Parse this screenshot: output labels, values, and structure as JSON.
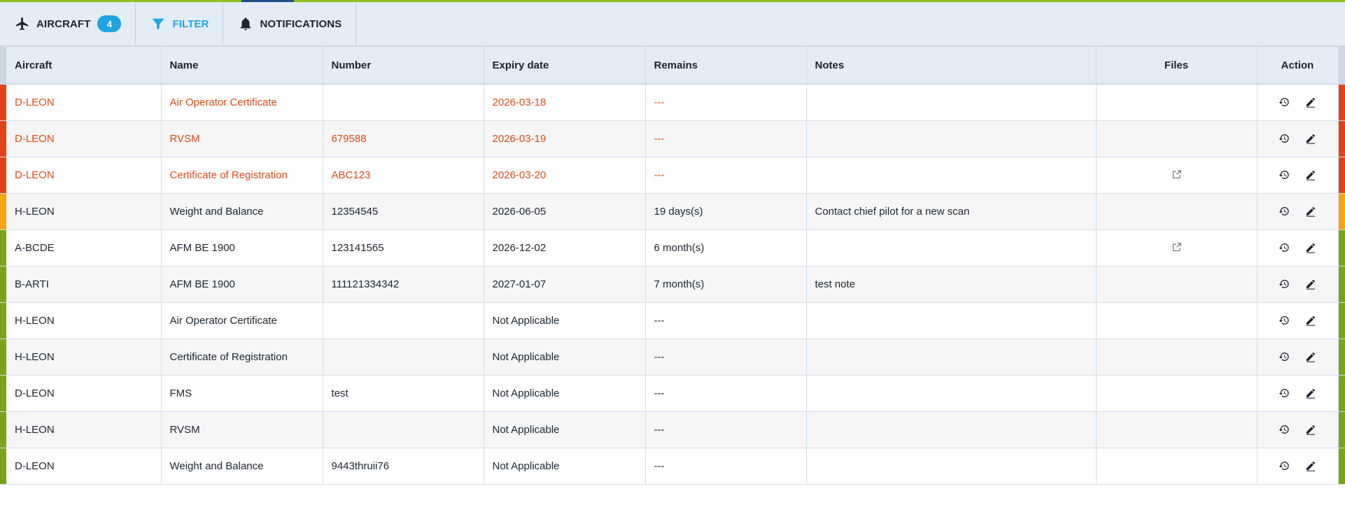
{
  "toolbar": {
    "tabs": [
      {
        "label": "AIRCRAFT",
        "icon": "airplane-icon",
        "badge": "4"
      },
      {
        "label": "FILTER",
        "icon": "funnel-icon"
      },
      {
        "label": "NOTIFICATIONS",
        "icon": "bell-icon"
      }
    ],
    "accent_color": "#1ea5e0"
  },
  "table": {
    "columns": [
      "Aircraft",
      "Name",
      "Number",
      "Expiry date",
      "Remains",
      "Notes",
      "Files",
      "Action"
    ],
    "rows": [
      {
        "aircraft": "D-LEON",
        "name": "Air Operator Certificate",
        "number": "",
        "expiry": "2026-03-18",
        "remains": "---",
        "notes": "",
        "file": false,
        "status": "red"
      },
      {
        "aircraft": "D-LEON",
        "name": "RVSM",
        "number": "679588",
        "expiry": "2026-03-19",
        "remains": "---",
        "notes": "",
        "file": false,
        "status": "red"
      },
      {
        "aircraft": "D-LEON",
        "name": "Certificate of Registration",
        "number": "ABC123",
        "expiry": "2026-03-20",
        "remains": "---",
        "notes": "",
        "file": true,
        "status": "red"
      },
      {
        "aircraft": "H-LEON",
        "name": "Weight and Balance",
        "number": "12354545",
        "expiry": "2026-06-05",
        "remains": "19 days(s)",
        "notes": "Contact chief pilot for a new scan",
        "file": false,
        "status": "orange"
      },
      {
        "aircraft": "A-BCDE",
        "name": "AFM BE 1900",
        "number": "123141565",
        "expiry": "2026-12-02",
        "remains": "6 month(s)",
        "notes": "",
        "file": true,
        "status": "green"
      },
      {
        "aircraft": "B-ARTI",
        "name": "AFM BE 1900",
        "number": "111121334342",
        "expiry": "2027-01-07",
        "remains": "7 month(s)",
        "notes": "test note",
        "file": false,
        "status": "green"
      },
      {
        "aircraft": "H-LEON",
        "name": "Air Operator Certificate",
        "number": "",
        "expiry": "Not Applicable",
        "remains": "---",
        "notes": "",
        "file": false,
        "status": "green"
      },
      {
        "aircraft": "H-LEON",
        "name": "Certificate of Registration",
        "number": "",
        "expiry": "Not Applicable",
        "remains": "---",
        "notes": "",
        "file": false,
        "status": "green"
      },
      {
        "aircraft": "D-LEON",
        "name": "FMS",
        "number": "test",
        "expiry": "Not Applicable",
        "remains": "---",
        "notes": "",
        "file": false,
        "status": "green"
      },
      {
        "aircraft": "H-LEON",
        "name": "RVSM",
        "number": "",
        "expiry": "Not Applicable",
        "remains": "---",
        "notes": "",
        "file": false,
        "status": "green"
      },
      {
        "aircraft": "D-LEON",
        "name": "Weight and Balance",
        "number": "9443thruii76",
        "expiry": "Not Applicable",
        "remains": "---",
        "notes": "",
        "file": false,
        "status": "green"
      }
    ],
    "action_icons": [
      "history-icon",
      "edit-pencil-icon"
    ],
    "file_icon": "open-external-icon",
    "status_colors": {
      "red": "#e0421a",
      "orange": "#f4a614",
      "green": "#75a61a",
      "overdue_text": "#de4a14"
    }
  }
}
